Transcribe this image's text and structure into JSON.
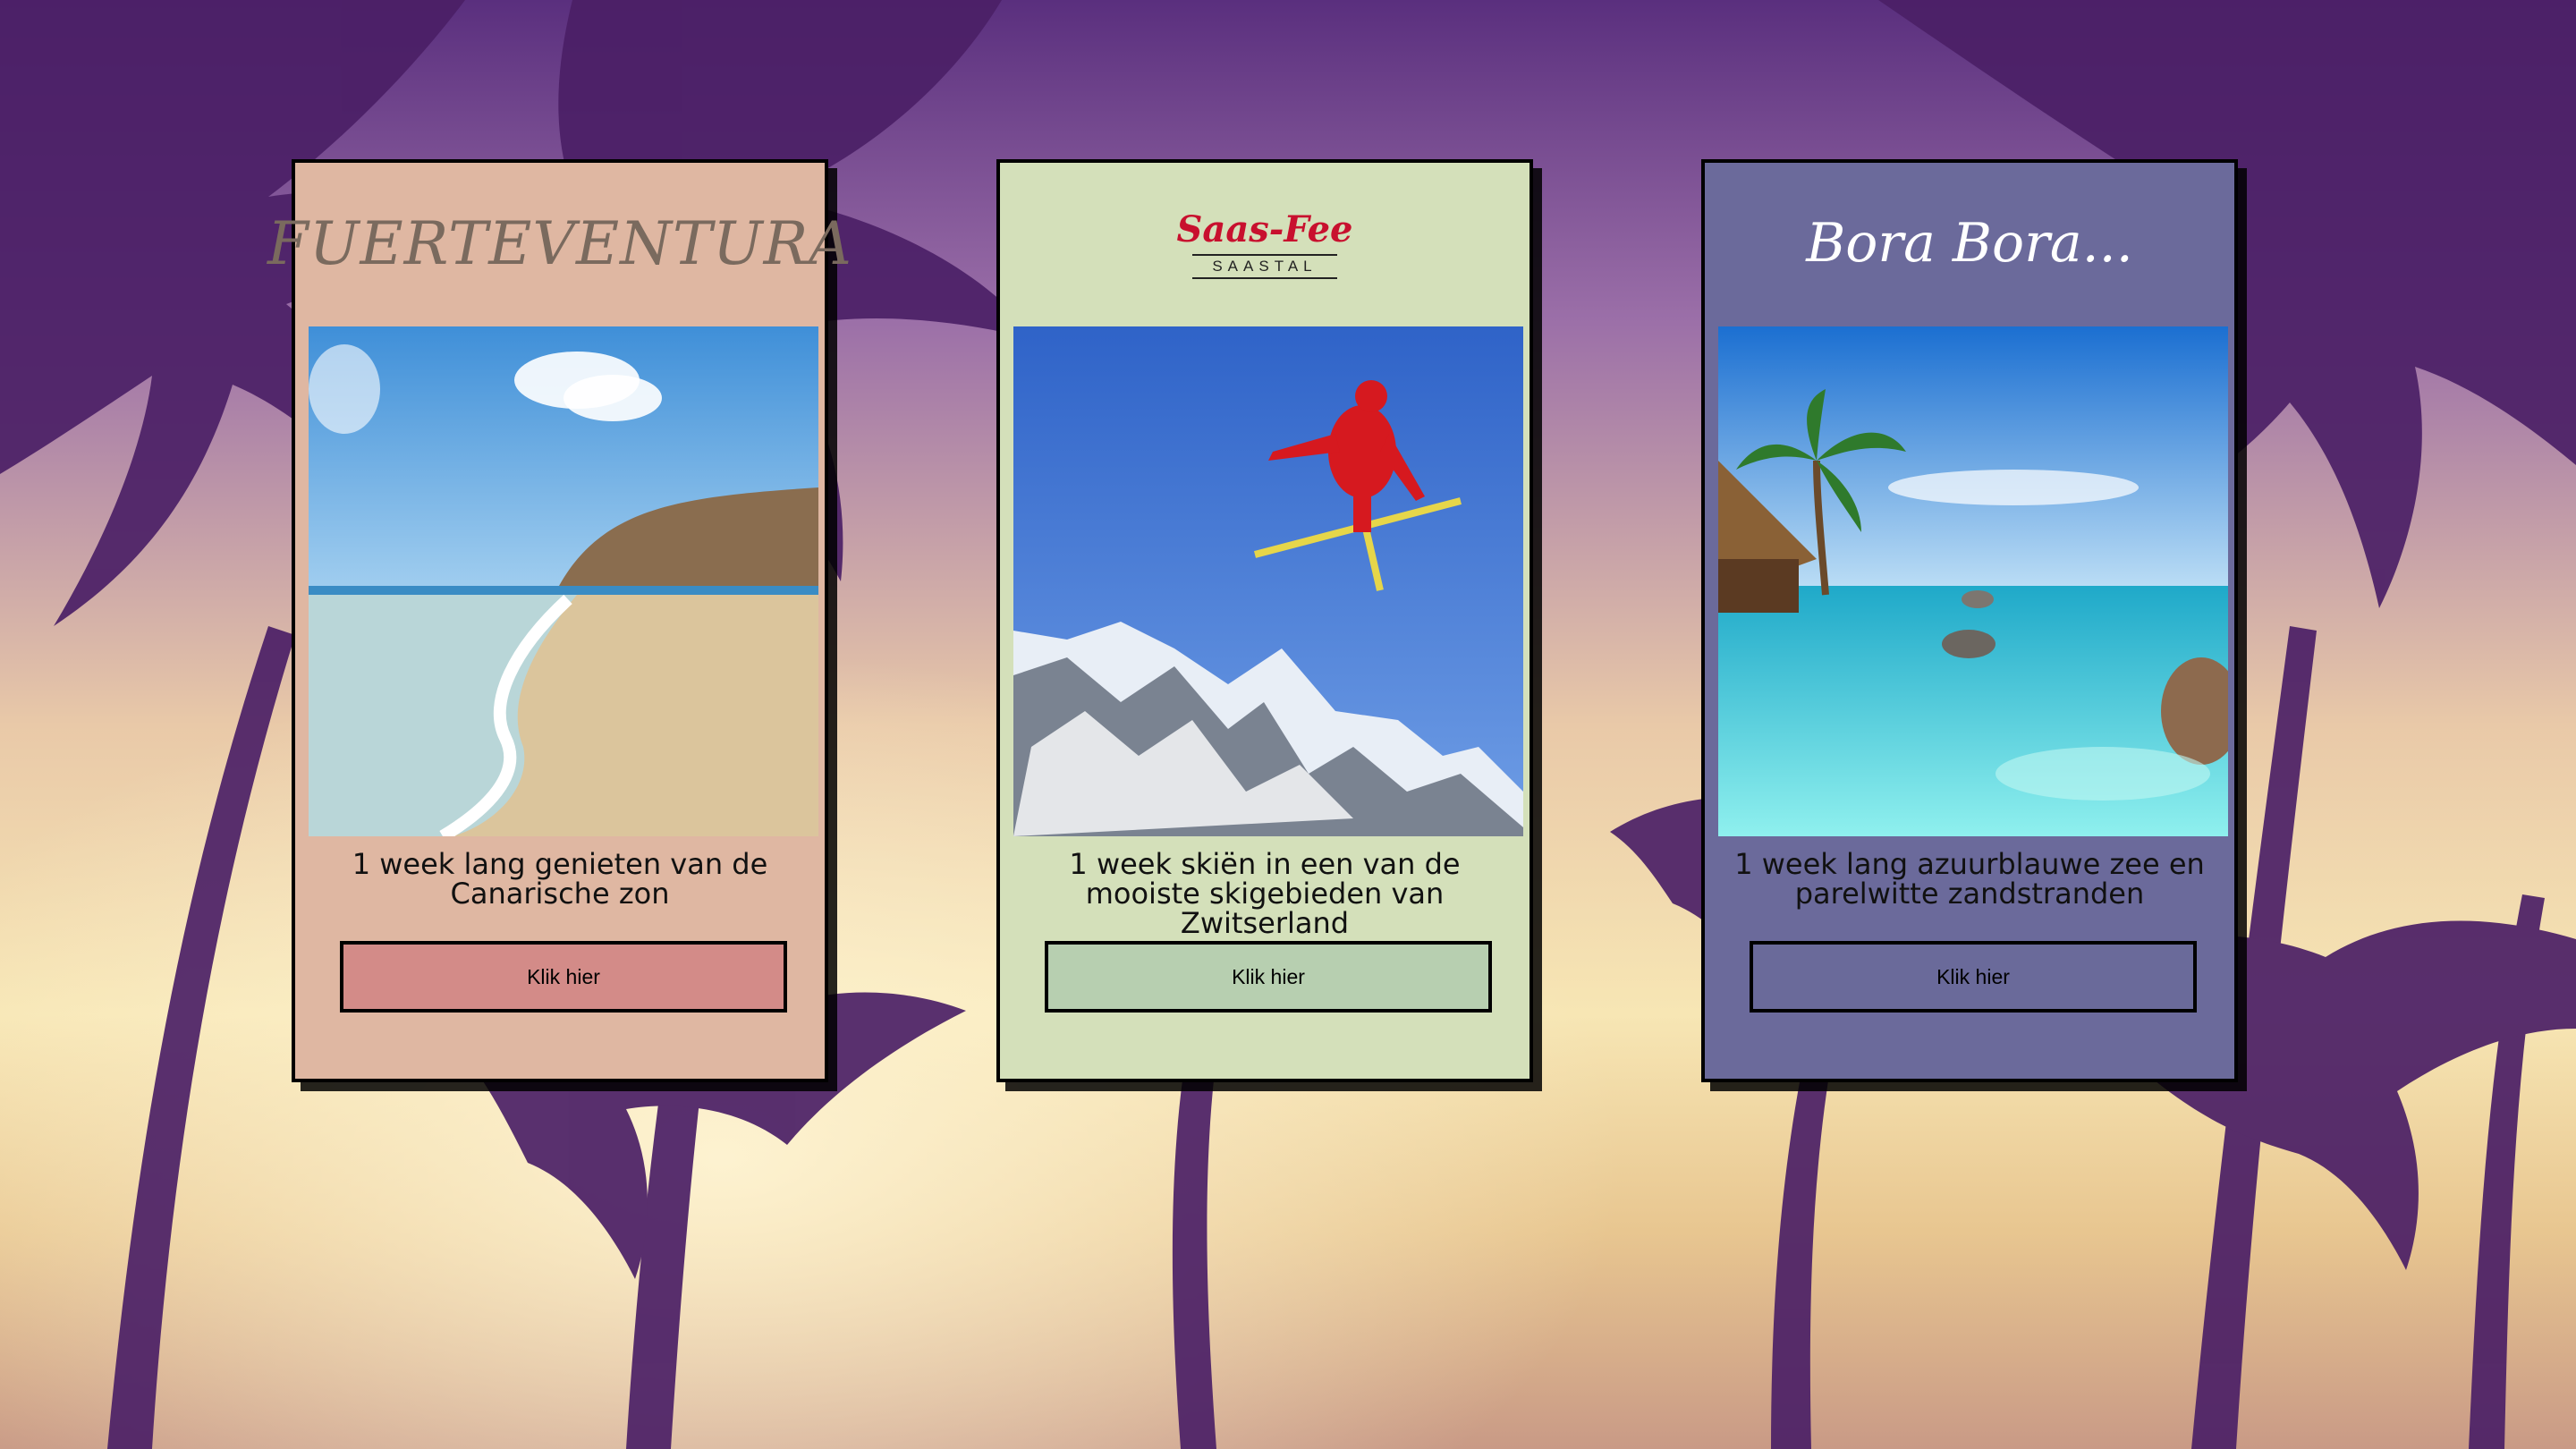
{
  "colors": {
    "card_1_bg": "#dfb7a2",
    "card_1_button": "#d38b88",
    "card_2_bg": "#d4e0ba",
    "card_2_button": "#b7cfb0",
    "card_3_bg": "#6b6a9b",
    "card_3_button": "#6a6a9a"
  },
  "cards": [
    {
      "logo_text": "FUERTEVENTURA",
      "description": "1 week lang genieten van de Canarische zon",
      "button_label": "Klik hier",
      "photo_icon": "beach-photo"
    },
    {
      "logo_text": "Saas-Fee",
      "logo_subtext": "SAASTAL",
      "description": "1 week skiën in een van de mooiste skigebieden van Zwitserland",
      "button_label": "Klik hier",
      "photo_icon": "skier-photo"
    },
    {
      "logo_text": "Bora Bora...",
      "description": "1 week lang azuurblauwe zee en parelwitte zandstranden",
      "button_label": "Klik hier",
      "photo_icon": "lagoon-photo"
    }
  ]
}
